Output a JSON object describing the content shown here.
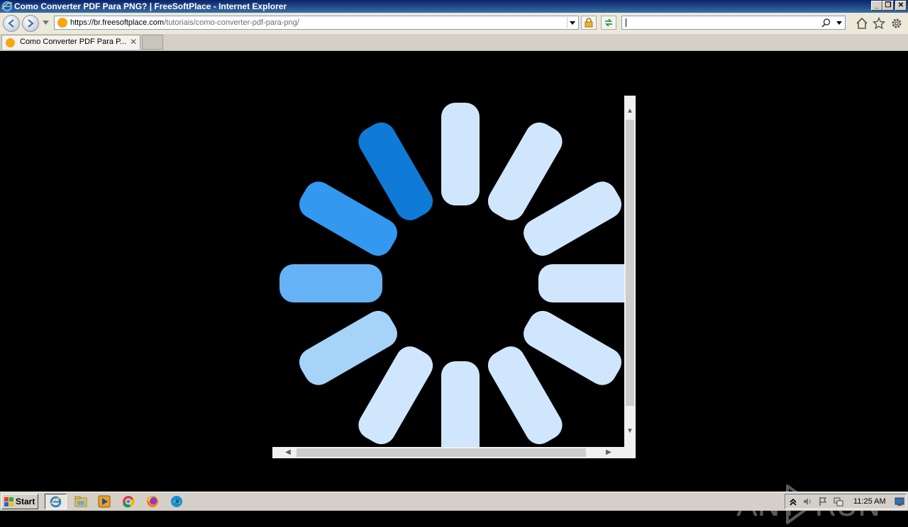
{
  "window": {
    "title": "Como Converter PDF Para PNG? | FreeSoftPlace - Internet Explorer",
    "controls": {
      "minimize": "_",
      "restore": "❐",
      "close": "✕"
    }
  },
  "navbar": {
    "url_host": "https://br.freesoftplace.com",
    "url_path": "/tutoriais/como-converter-pdf-para-png/",
    "search_value": ""
  },
  "tabs": [
    {
      "label": "Como Converter PDF Para P...",
      "close": "✕"
    }
  ],
  "content": {
    "spinner": {
      "bars": 12,
      "colors": {
        "active": "#0f7bd6",
        "trail1": "#3399f0",
        "trail2": "#66b2f7",
        "trail3": "#a6d3f8",
        "idle": "#d0e6fc"
      }
    },
    "scroll": {
      "up": "▲",
      "down": "▼",
      "left": "◀",
      "right": "▶"
    }
  },
  "watermark": {
    "left": "ANY",
    "right": "RUN"
  },
  "taskbar": {
    "start_label": "Start",
    "apps": [
      "internet-explorer",
      "file-explorer",
      "media-player",
      "chrome",
      "firefox",
      "edge"
    ],
    "clock": "11:25 AM"
  }
}
